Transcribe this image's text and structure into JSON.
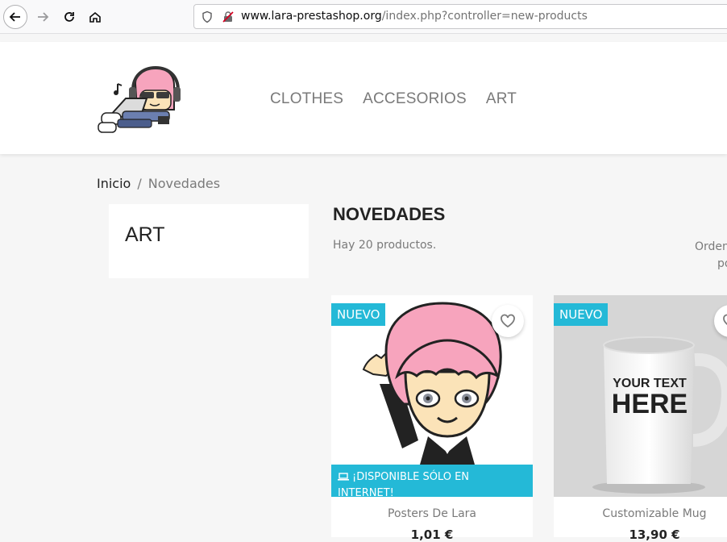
{
  "browser": {
    "url_host": "www.lara-prestashop.org",
    "url_path": "/index.php?controller=new-products"
  },
  "header": {
    "menu": [
      "CLOTHES",
      "ACCESORIOS",
      "ART"
    ]
  },
  "breadcrumb": {
    "home": "Inicio",
    "separator": "/",
    "current": "Novedades"
  },
  "sidebar": {
    "title": "ART"
  },
  "main": {
    "title": "NOVEDADES",
    "count_text": "Hay 20 productos.",
    "sort_label_line1": "Orden",
    "sort_label_line2": "po"
  },
  "products": [
    {
      "badge": "NUEVO",
      "online_flag": "¡DISPONIBLE SÓLO EN INTERNET!",
      "name": "Posters De Lara",
      "price": "1,01 €"
    },
    {
      "badge": "NUEVO",
      "mug_text_1": "YOUR TEXT",
      "mug_text_2": "HERE",
      "name": "Customizable Mug",
      "price": "13,90 €"
    }
  ],
  "colors": {
    "accent": "#24b9d7",
    "page_bg": "#f6f6f6",
    "hair_pink": "#f7a4bd"
  }
}
